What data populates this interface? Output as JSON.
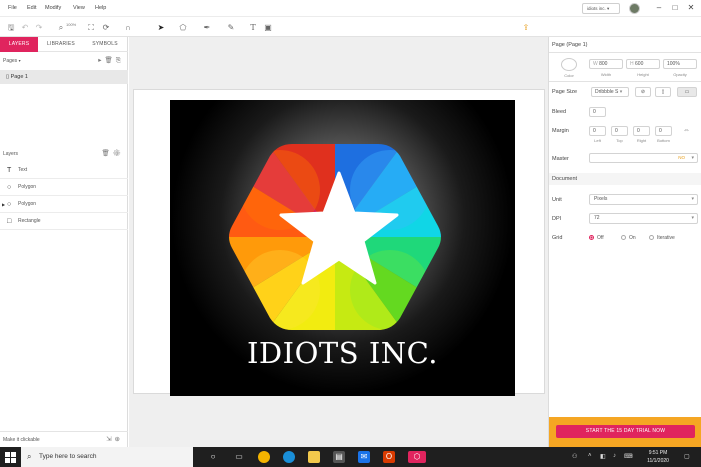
{
  "menubar": {
    "items": [
      "File",
      "Edit",
      "Modify",
      "View",
      "Help"
    ],
    "user_label": "idiots inc.",
    "window_controls": [
      "minimize-icon",
      "maximize-icon",
      "close-icon"
    ]
  },
  "toolbar": {
    "zoom_value": "100%",
    "icons": [
      "save-icon",
      "undo-icon",
      "redo-icon",
      "zoom-icon",
      "fit-icon",
      "rotate-icon",
      "magnet-icon",
      "select-tool-icon",
      "shape-tool-icon",
      "pen-tool-icon",
      "pencil-tool-icon",
      "text-tool-icon",
      "image-tool-icon",
      "export-icon"
    ]
  },
  "left_panel": {
    "tabs": [
      "LAYERS",
      "LIBRARIES",
      "SYMBOLS"
    ],
    "pages_label": "Pages",
    "page_item": "Page 1",
    "layers_label": "Layers",
    "layers": [
      {
        "icon": "T",
        "label": "Text"
      },
      {
        "icon": "○",
        "label": "Polygon"
      },
      {
        "icon": "○",
        "label": "Polygon",
        "expandable": true
      },
      {
        "icon": "□",
        "label": "Rectangle"
      }
    ],
    "bottom_label": "Make it clickable"
  },
  "canvas": {
    "logo_text": "IDIOTS INC.",
    "background_color": "#000000"
  },
  "right_panel": {
    "title": "Page (Page 1)",
    "color_sub": "Color",
    "width_prefix": "W",
    "width_value": "800",
    "width_sub": "Width",
    "height_prefix": "H",
    "height_value": "600",
    "height_sub": "Height",
    "opacity_value": "100%",
    "opacity_sub": "Opacity",
    "page_size_label": "Page Size",
    "page_size_value": "Dribbble S",
    "bleed_label": "Bleed",
    "bleed_value": "0",
    "margin_label": "Margin",
    "margin_values": [
      "0",
      "0",
      "0",
      "0"
    ],
    "margin_subs": [
      "Left",
      "Top",
      "Right",
      "Bottom"
    ],
    "master_label": "Master",
    "master_badge": "NO",
    "document_label": "Document",
    "unit_label": "Unit",
    "unit_value": "Pixels",
    "dpi_label": "DPI",
    "dpi_value": "72",
    "grid_label": "Grid",
    "grid_options": [
      "Off",
      "On",
      "Iterative"
    ],
    "grid_selected": "Off",
    "trial_button": "START THE 15 DAY TRIAL NOW",
    "accent_color": "#e0245e",
    "trial_bg": "#f5a623"
  },
  "taskbar": {
    "search_placeholder": "Type here to search",
    "time": "9:51 PM",
    "date": "11/1/2020"
  }
}
